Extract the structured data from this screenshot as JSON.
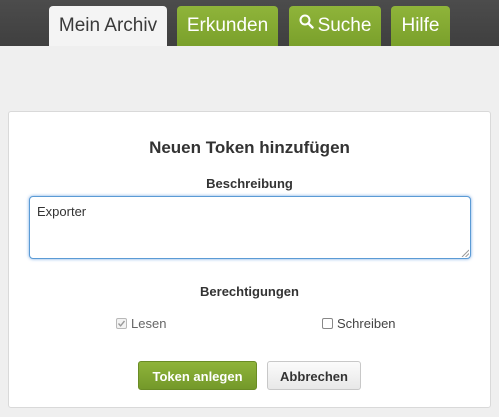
{
  "nav": {
    "tabs": [
      {
        "label": "Mein Archiv",
        "active": true
      },
      {
        "label": "Erkunden",
        "active": false
      },
      {
        "label": "Suche",
        "active": false,
        "icon": "search-icon"
      },
      {
        "label": "Hilfe",
        "active": false
      }
    ]
  },
  "dialog": {
    "title": "Neuen Token hinzufügen",
    "description_label": "Beschreibung",
    "description_value": "Exporter",
    "permissions_label": "Berechtigungen",
    "permissions": [
      {
        "label": "Lesen",
        "checked": true,
        "disabled": true
      },
      {
        "label": "Schreiben",
        "checked": false,
        "disabled": false
      }
    ],
    "create_button": "Token anlegen",
    "cancel_button": "Abbrechen"
  },
  "colors": {
    "accent_green": "#7aa02b",
    "topbar": "#444444",
    "focus_blue": "#5b9bd5"
  }
}
